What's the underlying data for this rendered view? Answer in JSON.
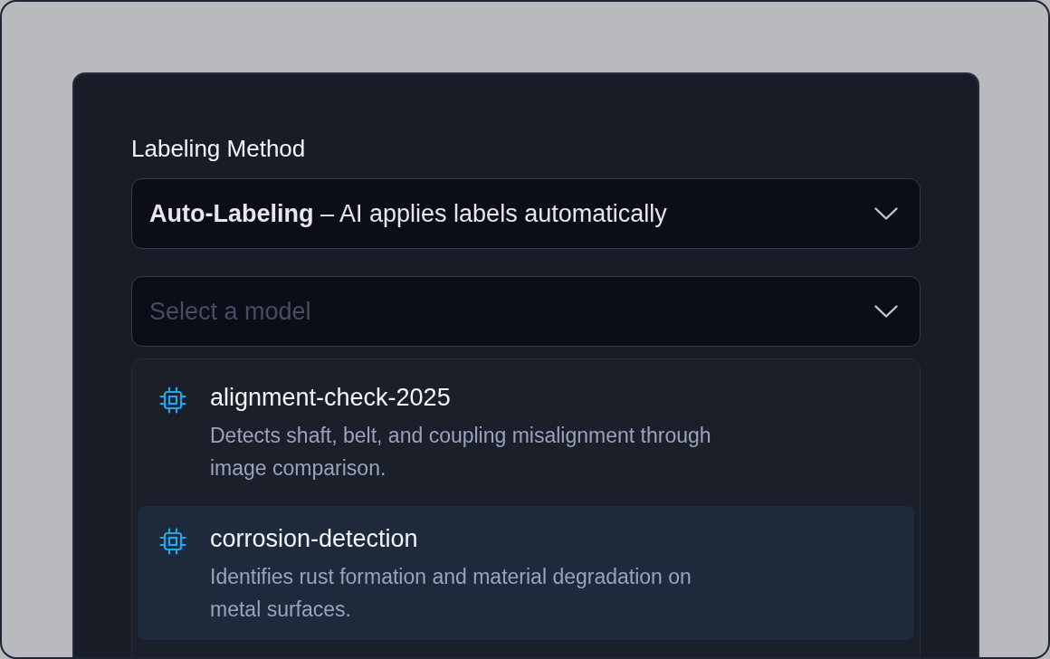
{
  "field_label": "Labeling Method",
  "method_select": {
    "value": "**Auto-Labeling** – AI applies labels automatically"
  },
  "model_select": {
    "placeholder": "Select a model"
  },
  "model_options": [
    {
      "name": "alignment-check-2025",
      "description": "Detects shaft, belt, and coupling misalignment through image comparison.",
      "selected": false
    },
    {
      "name": "corrosion-detection",
      "description": "Identifies rust formation and material degradation on metal surfaces.",
      "selected": true
    }
  ]
}
